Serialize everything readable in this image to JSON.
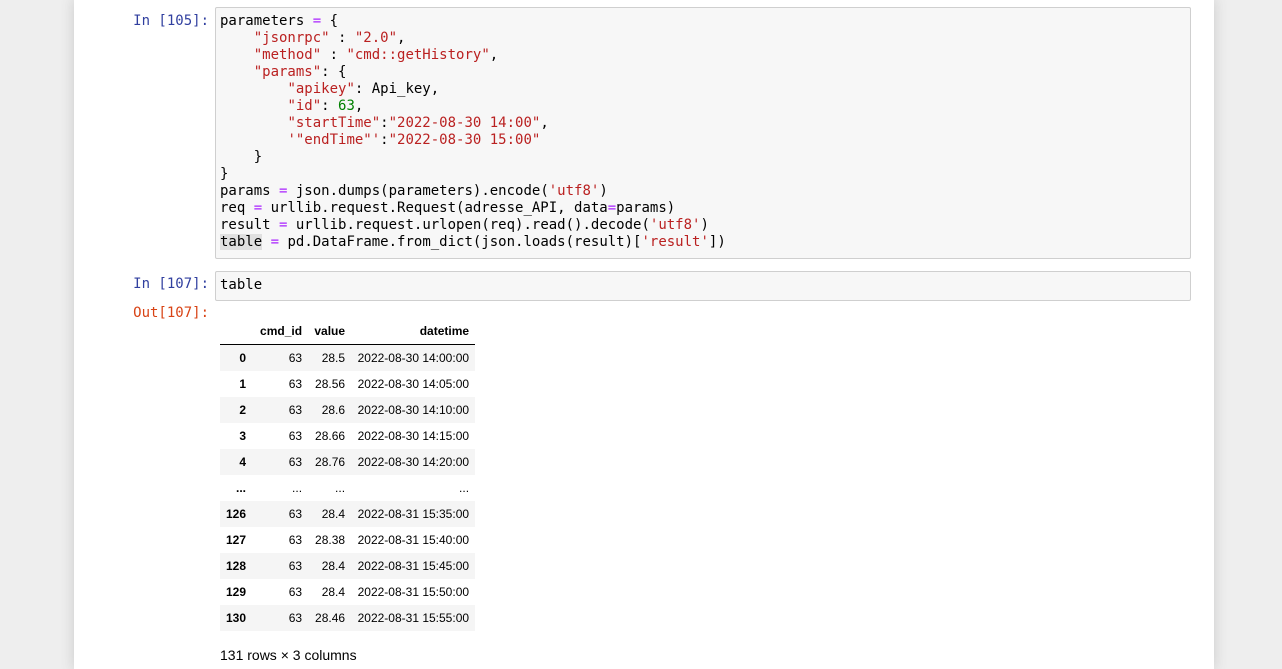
{
  "cells": [
    {
      "prompt": "In [105]:",
      "code_lines": [
        [
          {
            "t": "parameters "
          },
          {
            "t": "=",
            "c": "o"
          },
          {
            "t": " {"
          }
        ],
        [
          {
            "t": "    "
          },
          {
            "t": "\"jsonrpc\"",
            "c": "s"
          },
          {
            "t": " : "
          },
          {
            "t": "\"2.0\"",
            "c": "s"
          },
          {
            "t": ","
          }
        ],
        [
          {
            "t": "    "
          },
          {
            "t": "\"method\"",
            "c": "s"
          },
          {
            "t": " : "
          },
          {
            "t": "\"cmd::getHistory\"",
            "c": "s"
          },
          {
            "t": ","
          }
        ],
        [
          {
            "t": "    "
          },
          {
            "t": "\"params\"",
            "c": "s"
          },
          {
            "t": ": {"
          }
        ],
        [
          {
            "t": "        "
          },
          {
            "t": "\"apikey\"",
            "c": "s"
          },
          {
            "t": ": Api_key,"
          }
        ],
        [
          {
            "t": "        "
          },
          {
            "t": "\"id\"",
            "c": "s"
          },
          {
            "t": ": "
          },
          {
            "t": "63",
            "c": "n"
          },
          {
            "t": ","
          }
        ],
        [
          {
            "t": "        "
          },
          {
            "t": "\"startTime\"",
            "c": "s"
          },
          {
            "t": ":"
          },
          {
            "t": "\"2022-08-30 14:00\"",
            "c": "s"
          },
          {
            "t": ","
          }
        ],
        [
          {
            "t": "        "
          },
          {
            "t": "'\"endTime\"'",
            "c": "s"
          },
          {
            "t": ":"
          },
          {
            "t": "\"2022-08-30 15:00\"",
            "c": "s"
          }
        ],
        [
          {
            "t": "    }"
          }
        ],
        [
          {
            "t": "}"
          }
        ],
        [
          {
            "t": "params "
          },
          {
            "t": "=",
            "c": "o"
          },
          {
            "t": " json.dumps(parameters).encode("
          },
          {
            "t": "'utf8'",
            "c": "s"
          },
          {
            "t": ")"
          }
        ],
        [
          {
            "t": "req "
          },
          {
            "t": "=",
            "c": "o"
          },
          {
            "t": " urllib.request.Request(adresse_API, data"
          },
          {
            "t": "=",
            "c": "o"
          },
          {
            "t": "params)"
          }
        ],
        [
          {
            "t": "result "
          },
          {
            "t": "=",
            "c": "o"
          },
          {
            "t": " urllib.request.urlopen(req).read().decode("
          },
          {
            "t": "'utf8'",
            "c": "s"
          },
          {
            "t": ")"
          }
        ],
        [
          {
            "t": "table",
            "c": "hl"
          },
          {
            "t": " "
          },
          {
            "t": "=",
            "c": "o"
          },
          {
            "t": " pd.DataFrame.from_dict(json.loads(result)["
          },
          {
            "t": "'result'",
            "c": "s"
          },
          {
            "t": "])"
          }
        ]
      ]
    },
    {
      "prompt": "In [107]:",
      "code_lines": [
        [
          {
            "t": "table"
          }
        ]
      ]
    }
  ],
  "output": {
    "prompt": "Out[107]:",
    "columns": [
      "",
      "cmd_id",
      "value",
      "datetime"
    ],
    "rows": [
      [
        "0",
        "63",
        "28.5",
        "2022-08-30 14:00:00"
      ],
      [
        "1",
        "63",
        "28.56",
        "2022-08-30 14:05:00"
      ],
      [
        "2",
        "63",
        "28.6",
        "2022-08-30 14:10:00"
      ],
      [
        "3",
        "63",
        "28.66",
        "2022-08-30 14:15:00"
      ],
      [
        "4",
        "63",
        "28.76",
        "2022-08-30 14:20:00"
      ],
      [
        "...",
        "...",
        "...",
        "..."
      ],
      [
        "126",
        "63",
        "28.4",
        "2022-08-31 15:35:00"
      ],
      [
        "127",
        "63",
        "28.38",
        "2022-08-31 15:40:00"
      ],
      [
        "128",
        "63",
        "28.4",
        "2022-08-31 15:45:00"
      ],
      [
        "129",
        "63",
        "28.4",
        "2022-08-31 15:50:00"
      ],
      [
        "130",
        "63",
        "28.46",
        "2022-08-31 15:55:00"
      ]
    ],
    "shape": "131 rows × 3 columns"
  }
}
